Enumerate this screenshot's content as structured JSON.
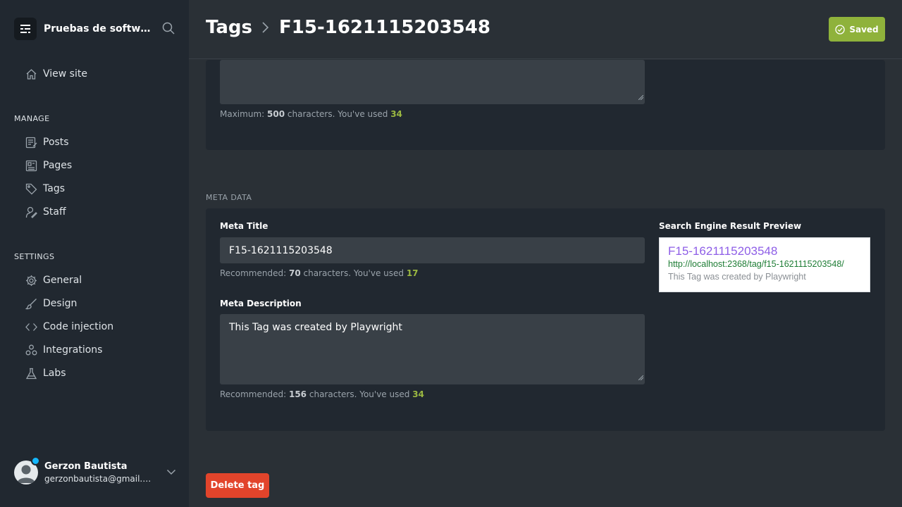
{
  "sidebar": {
    "site_name": "Pruebas de softwa...",
    "nav": {
      "view_site": "View site",
      "manage_heading": "MANAGE",
      "posts": "Posts",
      "pages": "Pages",
      "tags": "Tags",
      "staff": "Staff",
      "settings_heading": "SETTINGS",
      "general": "General",
      "design": "Design",
      "code_injection": "Code injection",
      "integrations": "Integrations",
      "labs": "Labs"
    },
    "user": {
      "name": "Gerzon Bautista",
      "email": "gerzonbautista@gmail.c..."
    }
  },
  "header": {
    "breadcrumb_parent": "Tags",
    "breadcrumb_current": "F15-1621115203548",
    "save_status": "Saved"
  },
  "description_card": {
    "hint_prefix": "Maximum:",
    "hint_max": "500",
    "hint_mid": "characters. You've used",
    "hint_used": "34"
  },
  "meta_data": {
    "section_label": "META DATA",
    "meta_title": {
      "label": "Meta Title",
      "value": "F15-1621115203548",
      "hint_prefix": "Recommended:",
      "hint_rec": "70",
      "hint_mid": "characters. You've used",
      "hint_used": "17"
    },
    "meta_description": {
      "label": "Meta Description",
      "value": "This Tag was created by Playwright",
      "hint_prefix": "Recommended:",
      "hint_rec": "156",
      "hint_mid": "characters. You've used",
      "hint_used": "34"
    },
    "preview": {
      "label": "Search Engine Result Preview",
      "title": "F15-1621115203548",
      "url": "http://localhost:2368/tag/f15-1621115203548/",
      "description": "This Tag was created by Playwright"
    }
  },
  "actions": {
    "delete_label": "Delete tag"
  },
  "colors": {
    "saved_green": "#8fb23b",
    "delete_red": "#e2442b",
    "used_count": "#9bb841",
    "preview_title": "#8e5ee7",
    "preview_url": "#1e7d35"
  }
}
